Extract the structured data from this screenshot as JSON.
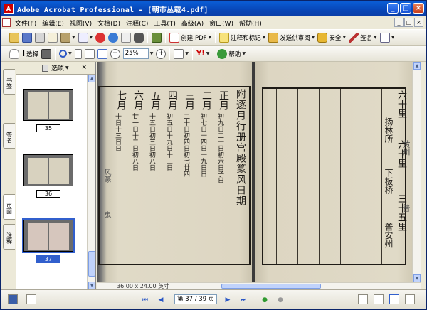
{
  "window": {
    "title": "Adobe Acrobat Professional - [朝市丛载4.pdf]",
    "app_icon_letter": "A",
    "buttons": {
      "minimize": "_",
      "maximize": "□",
      "close": "×"
    }
  },
  "menu": {
    "items": [
      "文件(F)",
      "编辑(E)",
      "视图(V)",
      "文档(D)",
      "注释(C)",
      "工具(T)",
      "高级(A)",
      "窗口(W)",
      "帮助(H)"
    ],
    "doc_buttons": [
      "_",
      "□",
      "×"
    ]
  },
  "toolbar1": {
    "create_pdf": "创建 PDF",
    "review_comment": "注释和标记",
    "send_review": "发送供审阅",
    "secure": "安全",
    "sign": "签名"
  },
  "toolbar2": {
    "select_label": "选择",
    "zoom_value": "25%",
    "help_label": "帮助"
  },
  "nav_tabs": [
    "书签",
    "签名",
    "页面",
    "注释"
  ],
  "pages_panel": {
    "options_label": "选项",
    "close": "×",
    "thumbnails": [
      {
        "label": "35",
        "selected": false
      },
      {
        "label": "36",
        "selected": false
      },
      {
        "label": "37",
        "selected": true
      }
    ]
  },
  "document": {
    "left_title": "附逐月行册宫殿篆风日期",
    "left_columns": [
      "正月",
      "二月",
      "三月",
      "四月",
      "五月",
      "六月",
      "七月"
    ],
    "left_column_text": [
      "初九日二十日初六日子日",
      "初七日十四日十九日日",
      "二十日初四日初七廿四",
      "初五日十九日十三日",
      "十五日初三日初八日",
      "廿一日十二日初八日",
      "十日十三日日"
    ],
    "left_notes": [
      "风篆",
      "鬼"
    ],
    "right_columns": [
      "六十里",
      "扬林所",
      "六十里",
      "下板桥",
      "三十五里",
      "普安州"
    ],
    "right_notes": [
      "黄州",
      "普"
    ]
  },
  "status": {
    "page_size": "36.00 x 24.00 英寸",
    "page_indicator": "第 37 / 39 页"
  }
}
